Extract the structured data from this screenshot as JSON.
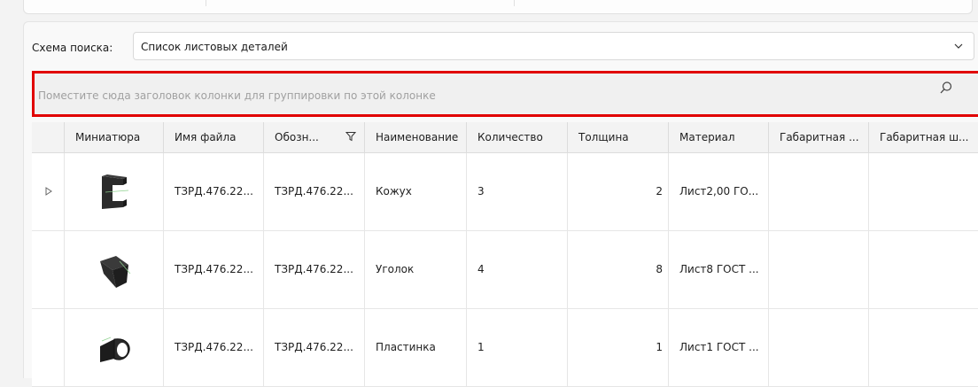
{
  "search_scheme": {
    "label": "Схема поиска:",
    "selected": "Список листовых деталей"
  },
  "group_panel": {
    "hint": "Поместите сюда заголовок колонки для группировки по этой колонке"
  },
  "grid": {
    "columns": [
      "Миниатюра",
      "Имя файла",
      "Обозн...",
      "Наименование",
      "Количество",
      "Толщина",
      "Материал",
      "Габаритная ...",
      "Габаритная ш..."
    ],
    "rows": [
      {
        "thumbnail": "bracket-c-shape-part",
        "file": "ТЗРД.476.22...",
        "designation": "ТЗРД.476.22...",
        "name": "Кожух",
        "quantity": "3",
        "thickness": "2",
        "material": "Лист2,00 ГО...",
        "dim1": "",
        "dim2": ""
      },
      {
        "thumbnail": "angle-bracket-part",
        "file": "ТЗРД.476.22...",
        "designation": "ТЗРД.476.22...",
        "name": "Уголок",
        "quantity": "4",
        "thickness": "8",
        "material": "Лист8 ГОСТ ...",
        "dim1": "",
        "dim2": ""
      },
      {
        "thumbnail": "plate-part",
        "file": "ТЗРД.476.22...",
        "designation": "ТЗРД.476.22...",
        "name": "Пластинка",
        "quantity": "1",
        "thickness": "1",
        "material": "Лист1 ГОСТ ...",
        "dim1": "",
        "dim2": ""
      }
    ]
  },
  "colors": {
    "highlight_border": "#e10000",
    "header_bg": "#f3f3f3"
  }
}
